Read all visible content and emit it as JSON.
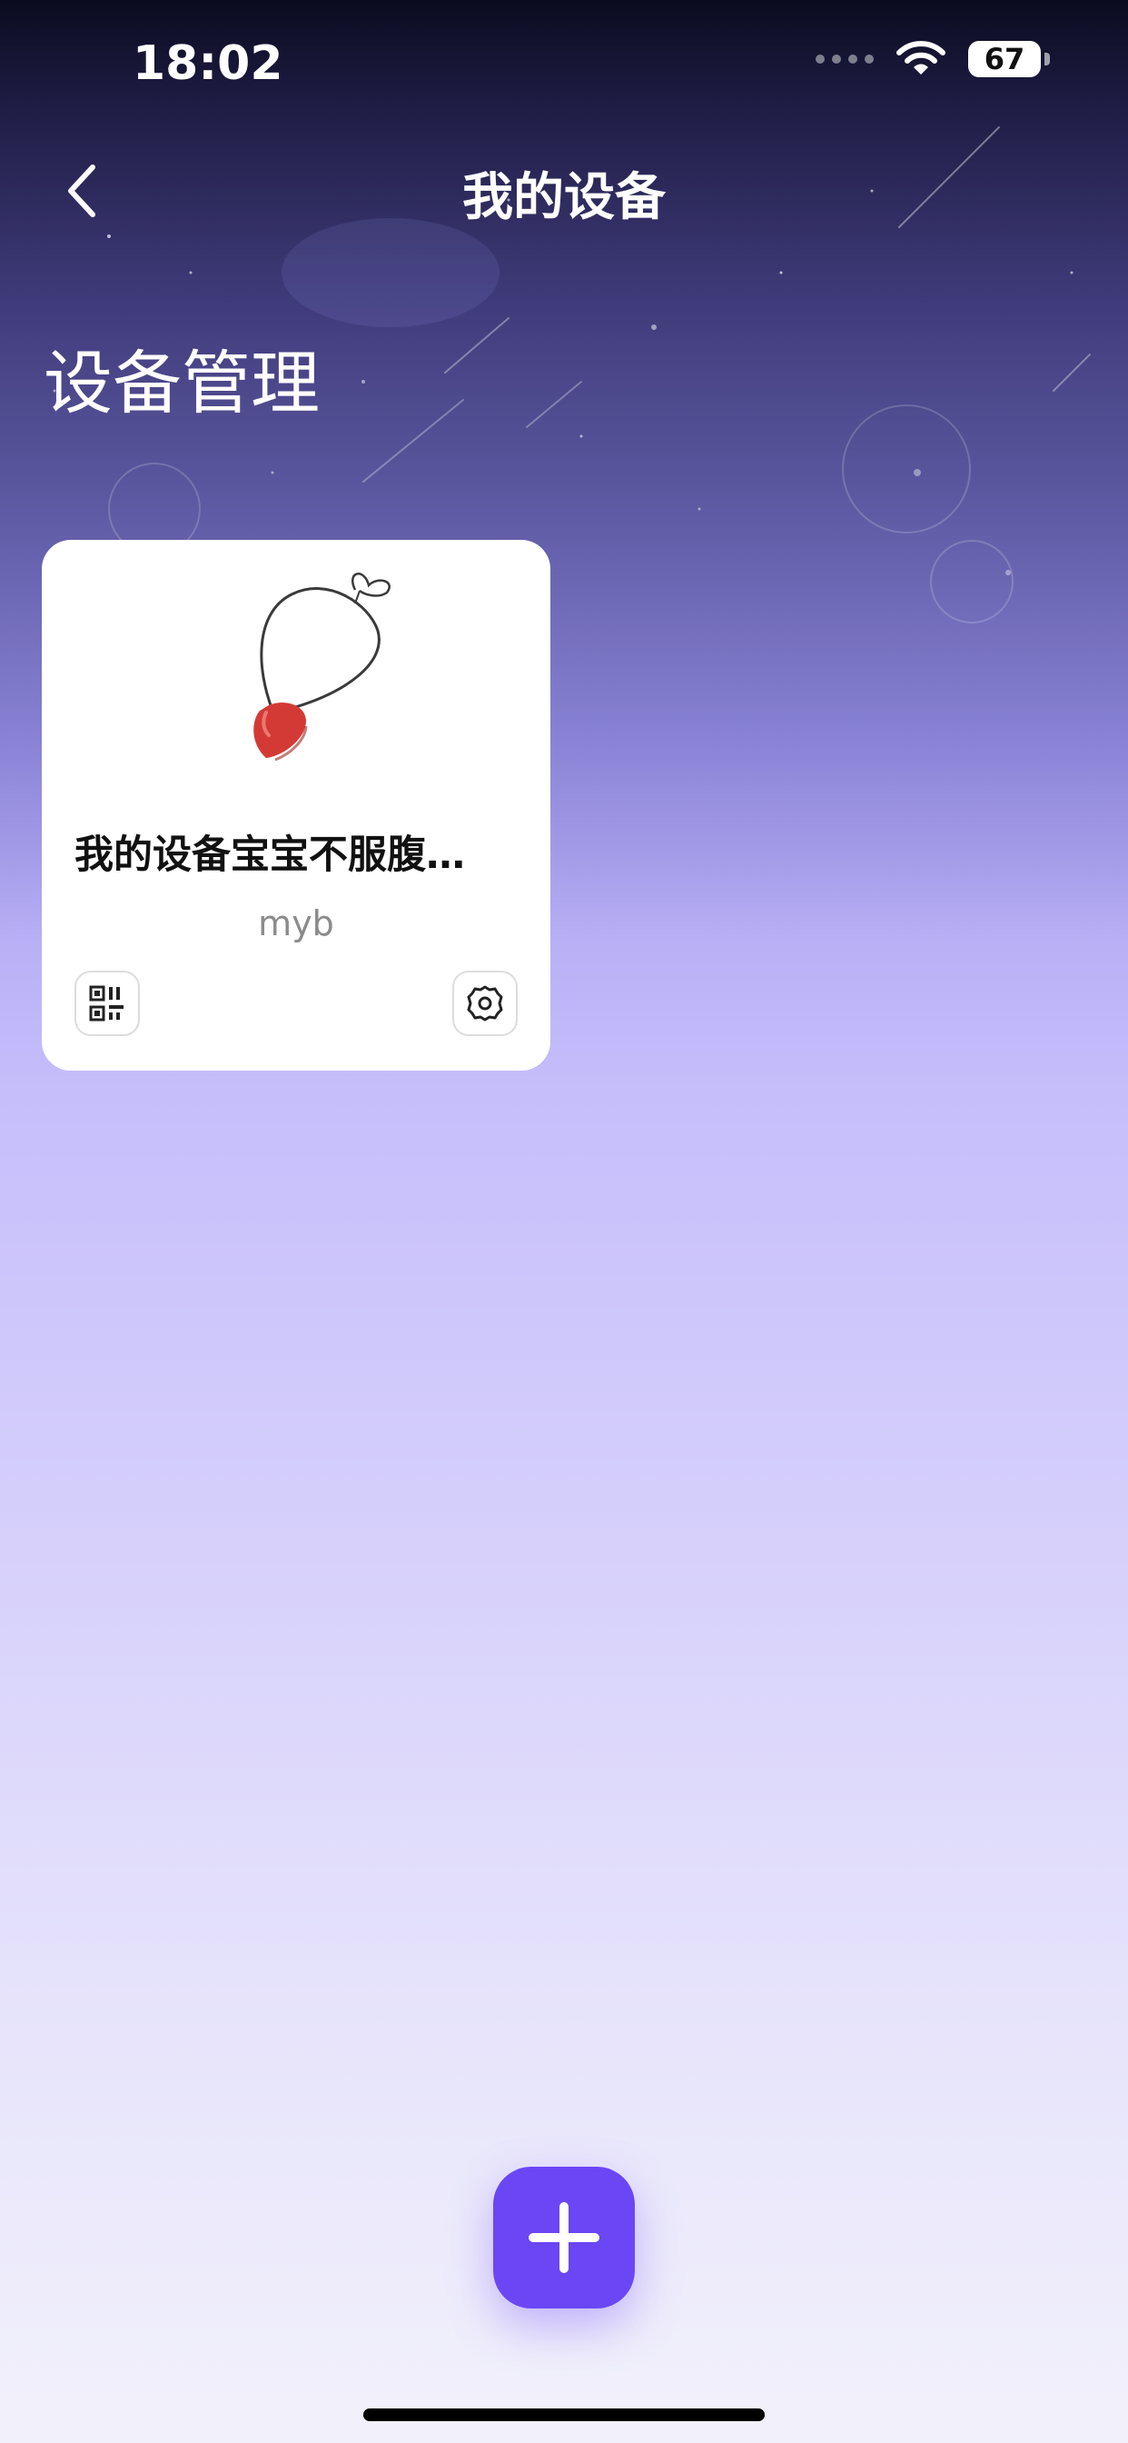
{
  "status_bar": {
    "time": "18:02",
    "battery": "67"
  },
  "nav": {
    "title": "我的设备"
  },
  "section": {
    "title": "设备管理"
  },
  "devices": [
    {
      "name": "我的设备宝宝不服腹…",
      "subtitle": "myb"
    }
  ],
  "colors": {
    "accent": "#6b46f5",
    "card_bg": "#ffffff",
    "subtitle": "#8b8b8b"
  }
}
